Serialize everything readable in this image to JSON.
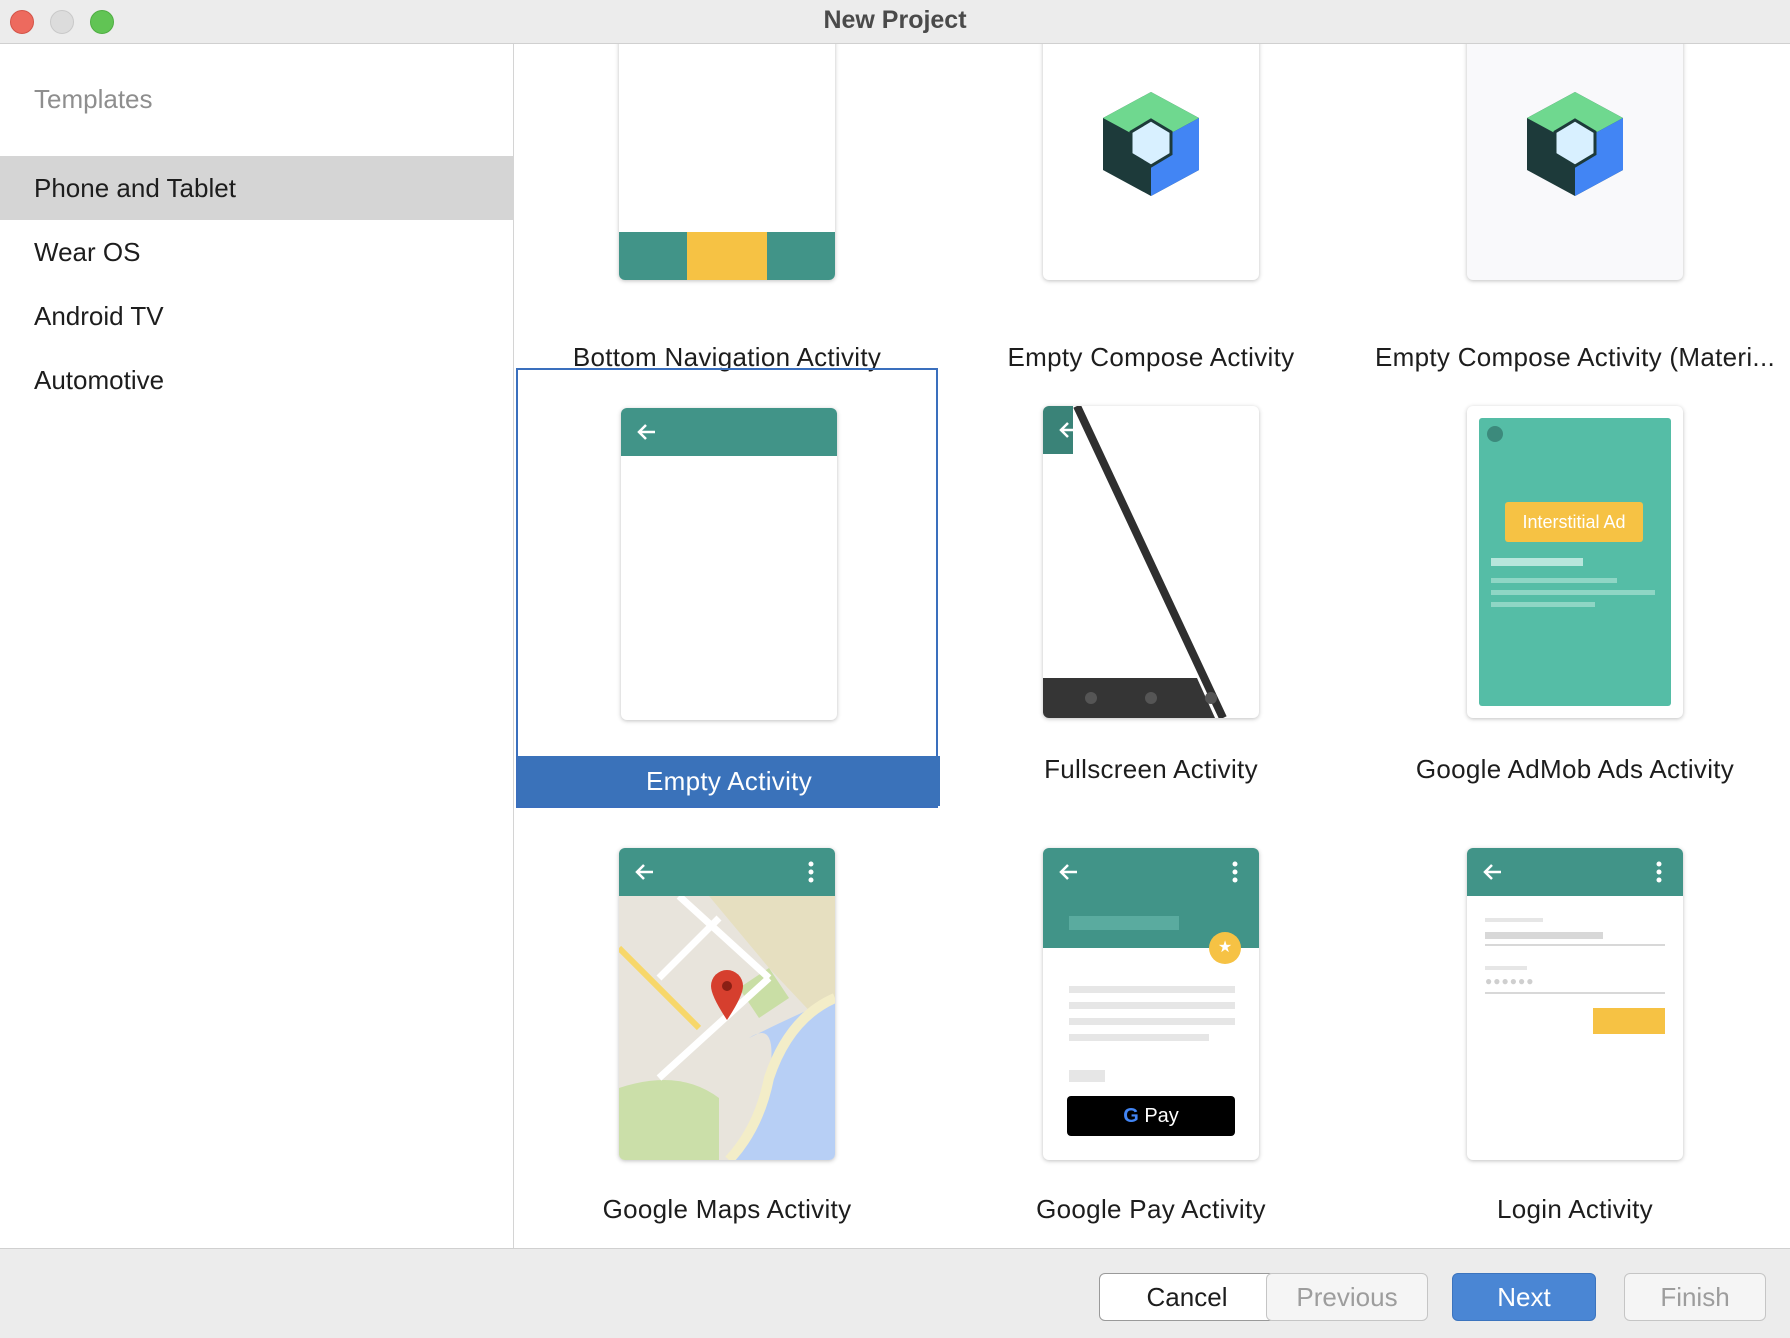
{
  "window": {
    "title": "New Project"
  },
  "sidebar": {
    "heading": "Templates",
    "items": [
      {
        "label": "Phone and Tablet",
        "selected": true
      },
      {
        "label": "Wear OS",
        "selected": false
      },
      {
        "label": "Android TV",
        "selected": false
      },
      {
        "label": "Automotive",
        "selected": false
      }
    ]
  },
  "templates": [
    {
      "label": "Bottom Navigation Activity",
      "selected": false
    },
    {
      "label": "Empty Compose Activity",
      "selected": false
    },
    {
      "label": "Empty Compose Activity (Materi...",
      "selected": false
    },
    {
      "label": "Empty Activity",
      "selected": true
    },
    {
      "label": "Fullscreen Activity",
      "selected": false
    },
    {
      "label": "Google AdMob Ads Activity",
      "selected": false
    },
    {
      "label": "Google Maps Activity",
      "selected": false
    },
    {
      "label": "Google Pay Activity",
      "selected": false
    },
    {
      "label": "Login Activity",
      "selected": false
    }
  ],
  "thumb_text": {
    "interstitial_ad": "Interstitial Ad",
    "pay_g": "G",
    "pay": "Pay"
  },
  "buttons": {
    "cancel": "Cancel",
    "previous": "Previous",
    "next": "Next",
    "finish": "Finish"
  },
  "colors": {
    "accent": "#3a72ba",
    "teal": "#419488",
    "yellow": "#f6c244"
  }
}
